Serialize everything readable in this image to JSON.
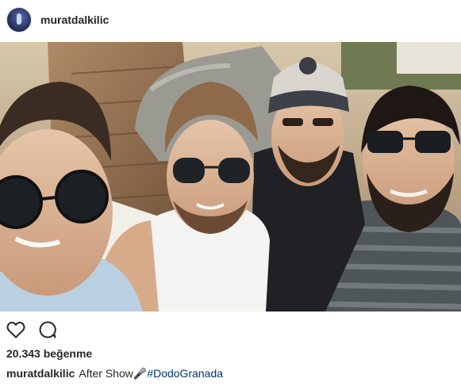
{
  "post": {
    "username": "muratdalkilic",
    "likes_text": "20.343 beğenme",
    "caption_text": "After Show",
    "caption_emoji": "🎤",
    "hashtag": "#DodoGranada"
  },
  "icons": {
    "like": "heart-outline-icon",
    "comment": "comment-bubble-icon"
  },
  "colors": {
    "text": "#262626",
    "hashtag": "#003569",
    "divider": "#dbdbdb"
  }
}
